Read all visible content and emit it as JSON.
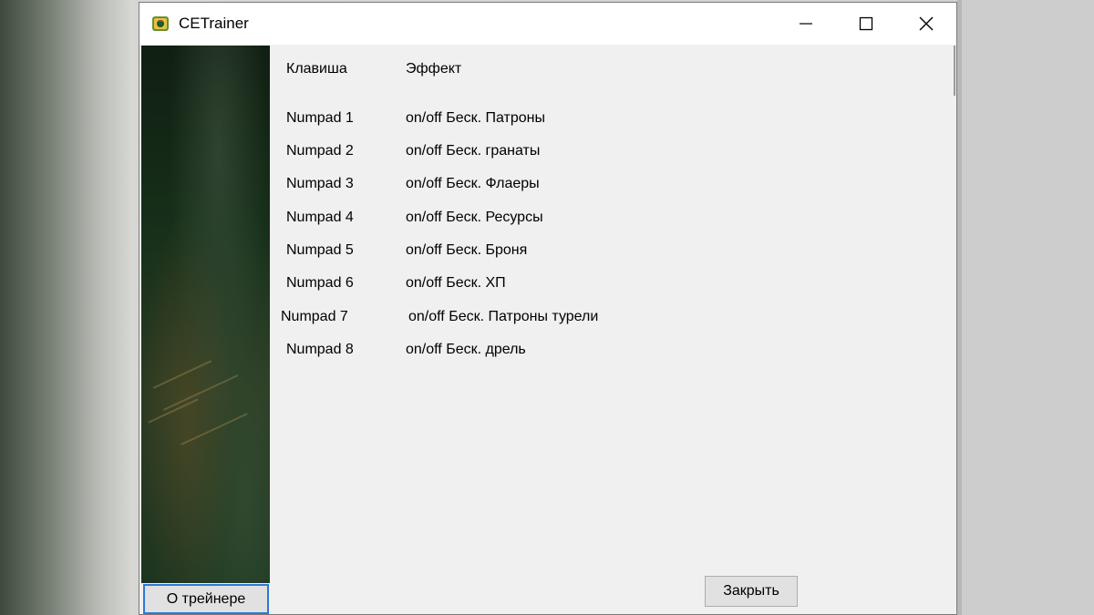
{
  "window": {
    "title": "CETrainer",
    "app_icon": "trainer-app-icon",
    "controls": {
      "minimize_icon": "minimize-icon",
      "maximize_icon": "maximize-icon",
      "close_icon": "close-icon"
    }
  },
  "table": {
    "headers": {
      "key": "Клавиша",
      "effect": "Эффект"
    },
    "rows": [
      {
        "key": "Numpad 1",
        "effect": "on/off Беск. Патроны"
      },
      {
        "key": "Numpad 2",
        "effect": "on/off Беск. гранаты"
      },
      {
        "key": "Numpad 3",
        "effect": "on/off Беск. Флаеры"
      },
      {
        "key": "Numpad 4",
        "effect": "on/off Беск. Ресурсы"
      },
      {
        "key": "Numpad 5",
        "effect": "on/off Беск. Броня"
      },
      {
        "key": "Numpad 6",
        "effect": "on/off Беск. ХП"
      },
      {
        "key": "Numpad 7",
        "effect": "on/off Беск. Патроны турели"
      },
      {
        "key": "Numpad 8",
        "effect": "on/off Беск. дрель"
      }
    ]
  },
  "buttons": {
    "about": "О трейнере",
    "close": "Закрыть"
  },
  "colors": {
    "focus_border": "#2b79d8",
    "button_face": "#e1e1e1",
    "window_bg": "#f0f0f0"
  }
}
